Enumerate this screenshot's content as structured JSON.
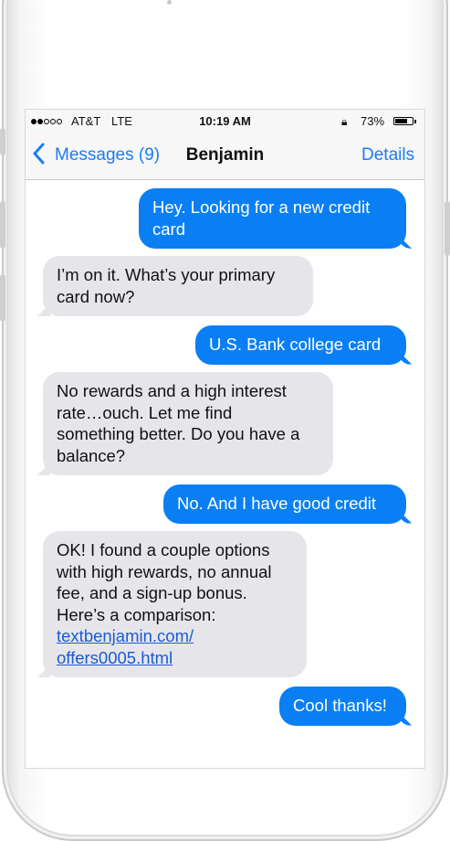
{
  "status_bar": {
    "carrier": "AT&T",
    "network": "LTE",
    "time": "10:19 AM",
    "lock_icon": "rotation-lock-icon",
    "battery": "73%",
    "battery_level": 0.73
  },
  "nav": {
    "back_icon": "chevron-left-icon",
    "back_label": "Messages (9)",
    "title": "Benjamin",
    "details_label": "Details"
  },
  "messages": [
    {
      "from": "me",
      "lines": [
        "Hey. Looking for a new credit",
        "card"
      ]
    },
    {
      "from": "them",
      "lines": [
        "I’m on it. What’s your primary",
        "card now?"
      ]
    },
    {
      "from": "me",
      "lines": [
        "U.S. Bank college card"
      ]
    },
    {
      "from": "them",
      "lines": [
        "No rewards and a high interest",
        "rate…ouch. Let me find",
        "something better. Do you have a",
        "balance?"
      ]
    },
    {
      "from": "me",
      "lines": [
        "No. And I have good credit"
      ]
    },
    {
      "from": "them",
      "lines": [
        "OK! I found a couple options",
        "with high rewards, no annual",
        "fee, and a sign-up bonus.",
        "Here’s a comparison:"
      ],
      "link_lines": [
        "textbenjamin.com/",
        "offers0005.html"
      ]
    },
    {
      "from": "me",
      "lines": [
        "Cool thanks!"
      ]
    }
  ],
  "colors": {
    "outgoing_bubble": "#0a7ff4",
    "incoming_bubble": "#e6e6ea",
    "accent": "#1a7cf5",
    "link": "#1a5ad8"
  }
}
